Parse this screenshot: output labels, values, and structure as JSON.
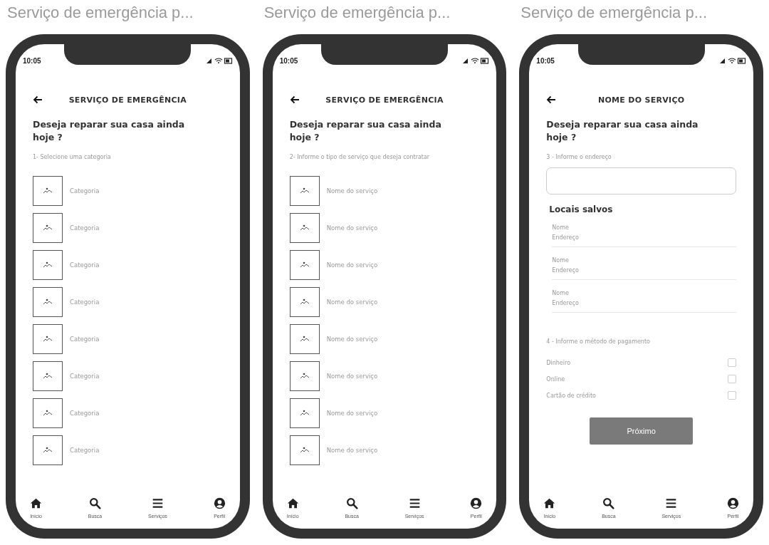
{
  "screens": [
    {
      "caption": "Serviço de emergência p...",
      "time": "10:05",
      "header": "SERVIÇO DE EMERGÊNCIA",
      "question": "Deseja reparar sua casa ainda hoje ?",
      "step": "1- Selecione uma categoria",
      "kind": "list",
      "items": [
        "Categoria",
        "Categoria",
        "Categoria",
        "Categoria",
        "Categoria",
        "Categoria",
        "Categoria",
        "Categoria"
      ],
      "nav": [
        {
          "kind": "home",
          "label": "Início"
        },
        {
          "kind": "search",
          "label": "Busca"
        },
        {
          "kind": "menu",
          "label": "Serviços"
        },
        {
          "kind": "profile",
          "label": "Perfil"
        }
      ]
    },
    {
      "caption": "Serviço de emergência p...",
      "time": "10:05",
      "header": "SERVIÇO DE EMERGÊNCIA",
      "question": "Deseja reparar sua casa ainda hoje ?",
      "step": "2- Informe o tipo de serviço que deseja contratar",
      "kind": "list",
      "items": [
        "Nome do serviço",
        "Nome do serviço",
        "Nome do serviço",
        "Nome do serviço",
        "Nome do serviço",
        "Nome do serviço",
        "Nome do serviço",
        "Nome do serviço"
      ],
      "nav": [
        {
          "kind": "home",
          "label": "Início"
        },
        {
          "kind": "search",
          "label": "Busca"
        },
        {
          "kind": "menu",
          "label": "Serviços"
        },
        {
          "kind": "profile",
          "label": "Perfil"
        }
      ]
    },
    {
      "caption": "Serviço de emergência p...",
      "time": "10:05",
      "header": "NOME DO SERVIÇO",
      "question": "Deseja reparar sua casa ainda hoje ?",
      "step": "3 - Informe o endereço",
      "kind": "form",
      "saved_title": "Locais salvos",
      "saved": [
        {
          "name": "Nome",
          "address": "Endereço"
        },
        {
          "name": "Nome",
          "address": "Endereço"
        },
        {
          "name": "Nome",
          "address": "Endereço"
        }
      ],
      "payment_label": "4 - Informe o método de pagamento",
      "payment_options": [
        {
          "label": "Dinheiro",
          "checked": false
        },
        {
          "label": "Online",
          "checked": false
        },
        {
          "label": "Cartão de crédito",
          "checked": false
        }
      ],
      "button": "Próximo",
      "nav": [
        {
          "kind": "home",
          "label": "Início"
        },
        {
          "kind": "search",
          "label": "Busca"
        },
        {
          "kind": "menu",
          "label": "Serviços"
        },
        {
          "kind": "profile",
          "label": "Perfil"
        }
      ]
    }
  ]
}
